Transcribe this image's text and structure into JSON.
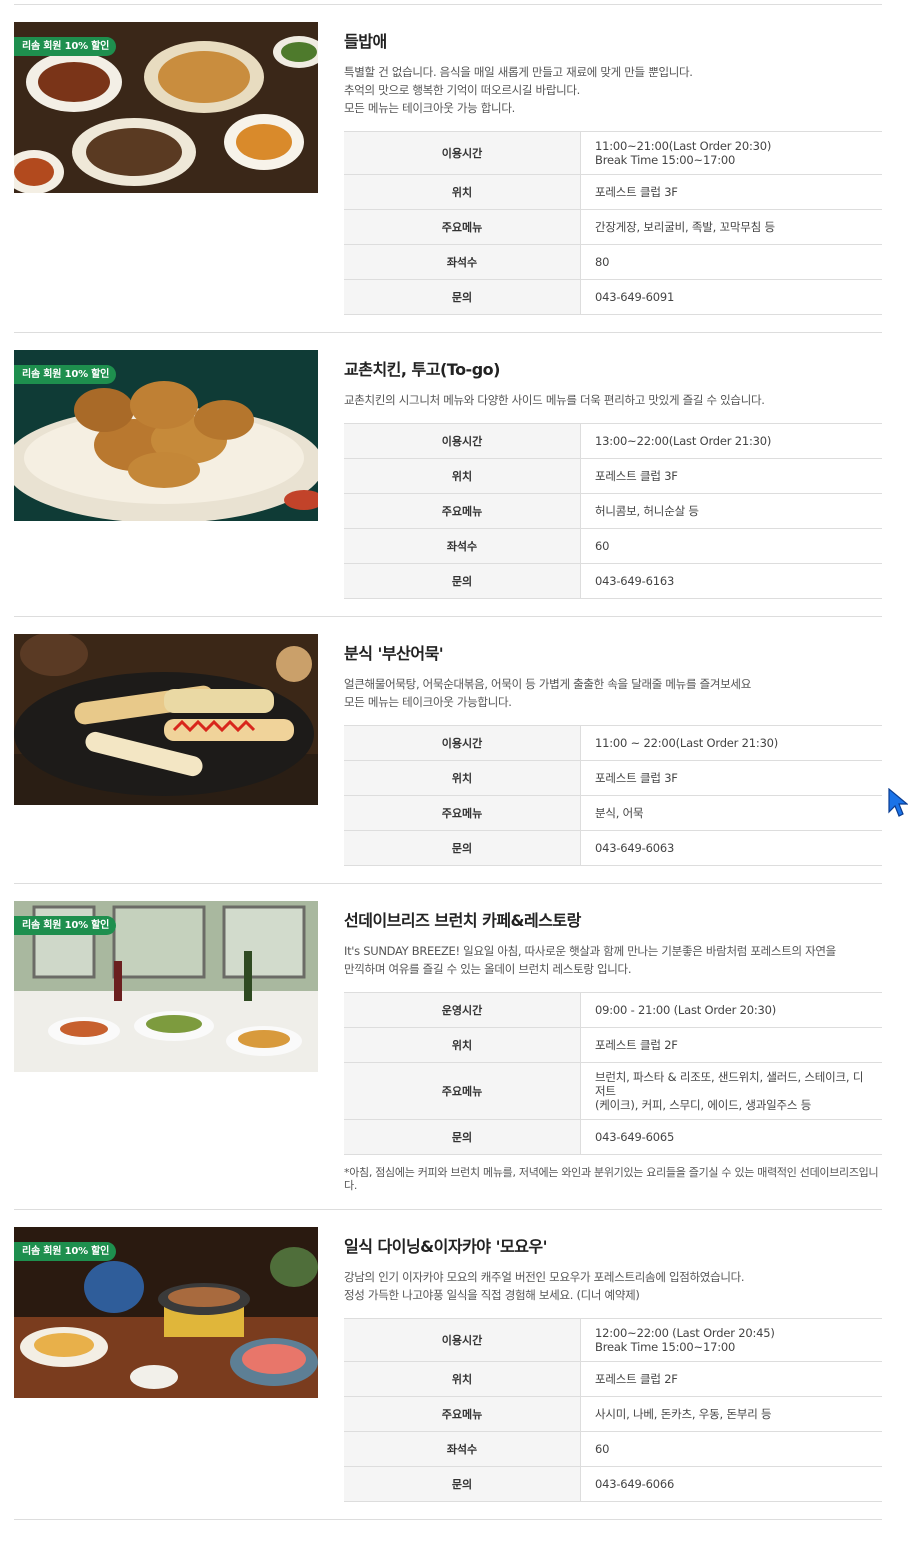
{
  "badge_text": "리솜 회원 10% 할인",
  "colors": {
    "badge_bg": "#1e8f4e",
    "header_bg": "#f5f5f5",
    "border": "#dddddd"
  },
  "restaurants": [
    {
      "name": "들밥애",
      "has_badge": true,
      "image_icon": "korean-banchan-table-photo",
      "description": [
        "특별할 건 없습니다. 음식을 매일 새롭게 만들고 재료에 맞게 만들 뿐입니다.",
        "추억의 맛으로 행복한 기억이 떠오르시길 바랍니다.",
        "모든 메뉴는 테이크아웃 가능 합니다."
      ],
      "rows": [
        {
          "label": "이용시간",
          "value": [
            "11:00~21:00(Last Order 20:30)",
            "Break Time 15:00~17:00"
          ]
        },
        {
          "label": "위치",
          "value": [
            "포레스트 클럽 3F"
          ]
        },
        {
          "label": "주요메뉴",
          "value": [
            "간장게장, 보리굴비, 족발, 꼬막무침 등"
          ]
        },
        {
          "label": "좌석수",
          "value": [
            "80"
          ]
        },
        {
          "label": "문의",
          "value": [
            "043-649-6091"
          ]
        }
      ],
      "note": ""
    },
    {
      "name": "교촌치킨, 투고(To-go)",
      "has_badge": true,
      "image_icon": "fried-chicken-plate-photo",
      "description": [
        "교촌치킨의 시그니처 메뉴와 다양한 사이드 메뉴를 더욱 편리하고 맛있게 즐길 수 있습니다."
      ],
      "rows": [
        {
          "label": "이용시간",
          "value": [
            "13:00~22:00(Last Order 21:30)"
          ]
        },
        {
          "label": "위치",
          "value": [
            "포레스트 클럽 3F"
          ]
        },
        {
          "label": "주요메뉴",
          "value": [
            "허니콤보, 허니순살 등"
          ]
        },
        {
          "label": "좌석수",
          "value": [
            "60"
          ]
        },
        {
          "label": "문의",
          "value": [
            "043-649-6163"
          ]
        }
      ],
      "note": ""
    },
    {
      "name": "분식 '부산어묵'",
      "has_badge": false,
      "image_icon": "fish-cake-skewers-photo",
      "description": [
        "얼큰해물어묵탕, 어묵순대볶음, 어묵이 등 가볍게 출출한 속을 달래줄 메뉴를 즐겨보세요",
        "모든 메뉴는 테이크아웃 가능합니다."
      ],
      "rows": [
        {
          "label": "이용시간",
          "value": [
            "11:00 ~ 22:00(Last Order 21:30)"
          ]
        },
        {
          "label": "위치",
          "value": [
            "포레스트 클럽 3F"
          ]
        },
        {
          "label": "주요메뉴",
          "value": [
            "분식, 어묵"
          ]
        },
        {
          "label": "문의",
          "value": [
            "043-649-6063"
          ]
        }
      ],
      "note": ""
    },
    {
      "name": "선데이브리즈 브런치 카페&레스토랑",
      "has_badge": true,
      "image_icon": "brunch-table-window-photo",
      "description": [
        "It's SUNDAY BREEZE! 일요일 아침, 따사로운 햇살과 함께 만나는 기분좋은 바람처럼 포레스트의 자연을",
        "만끽하며 여유를 즐길 수 있는 올데이 브런치 레스토랑 입니다."
      ],
      "rows": [
        {
          "label": "운영시간",
          "value": [
            "09:00 - 21:00 (Last Order 20:30)"
          ]
        },
        {
          "label": "위치",
          "value": [
            "포레스트 클럽 2F"
          ]
        },
        {
          "label": "주요메뉴",
          "value": [
            "브런치, 파스타 & 리조또, 샌드위치, 샐러드, 스테이크, 디저트",
            "(케이크), 커피, 스무디, 에이드, 생과일주스 등"
          ]
        },
        {
          "label": "문의",
          "value": [
            "043-649-6065"
          ]
        }
      ],
      "note": "*아침, 점심에는 커피와 브런치 메뉴를, 저녁에는 와인과 분위기있는 요리들을 즐기실 수 있는 매력적인 선데이브리즈입니다."
    },
    {
      "name": "일식 다이닝&이자카야 '모요우'",
      "has_badge": true,
      "image_icon": "japanese-izakaya-table-photo",
      "description": [
        "강남의 인기 이자카야 모요의 캐주얼 버전인 모요우가 포레스트리솜에 입점하였습니다.",
        "정성 가득한 나고야풍 일식을 직접 경험해 보세요. (디너 예약제)"
      ],
      "rows": [
        {
          "label": "이용시간",
          "value": [
            "12:00~22:00 (Last Order 20:45)",
            "Break Time 15:00~17:00"
          ]
        },
        {
          "label": "위치",
          "value": [
            "포레스트 클럽 2F"
          ]
        },
        {
          "label": "주요메뉴",
          "value": [
            "사시미, 나베, 돈카츠, 우동, 돈부리 등"
          ]
        },
        {
          "label": "좌석수",
          "value": [
            "60"
          ]
        },
        {
          "label": "문의",
          "value": [
            "043-649-6066"
          ]
        }
      ],
      "note": ""
    }
  ]
}
